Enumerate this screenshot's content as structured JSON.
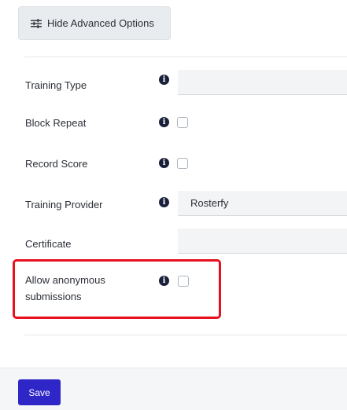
{
  "advanced_toggle": {
    "label": "Hide Advanced Options",
    "icon": "sliders-icon"
  },
  "fields": {
    "training_type": {
      "label": "Training Type",
      "value": ""
    },
    "block_repeat": {
      "label": "Block Repeat",
      "checked": false
    },
    "record_score": {
      "label": "Record Score",
      "checked": false
    },
    "training_provider": {
      "label": "Training Provider",
      "value": "Rosterfy"
    },
    "certificate": {
      "label": "Certificate",
      "value": ""
    },
    "allow_anonymous": {
      "label_line1": "Allow anonymous",
      "label_line2": "submissions",
      "checked": false
    }
  },
  "info_glyph": "i",
  "footer": {
    "save_label": "Save"
  },
  "colors": {
    "accent": "#2e26c7",
    "highlight": "#e8101e",
    "info_icon": "#1a1f3a"
  }
}
